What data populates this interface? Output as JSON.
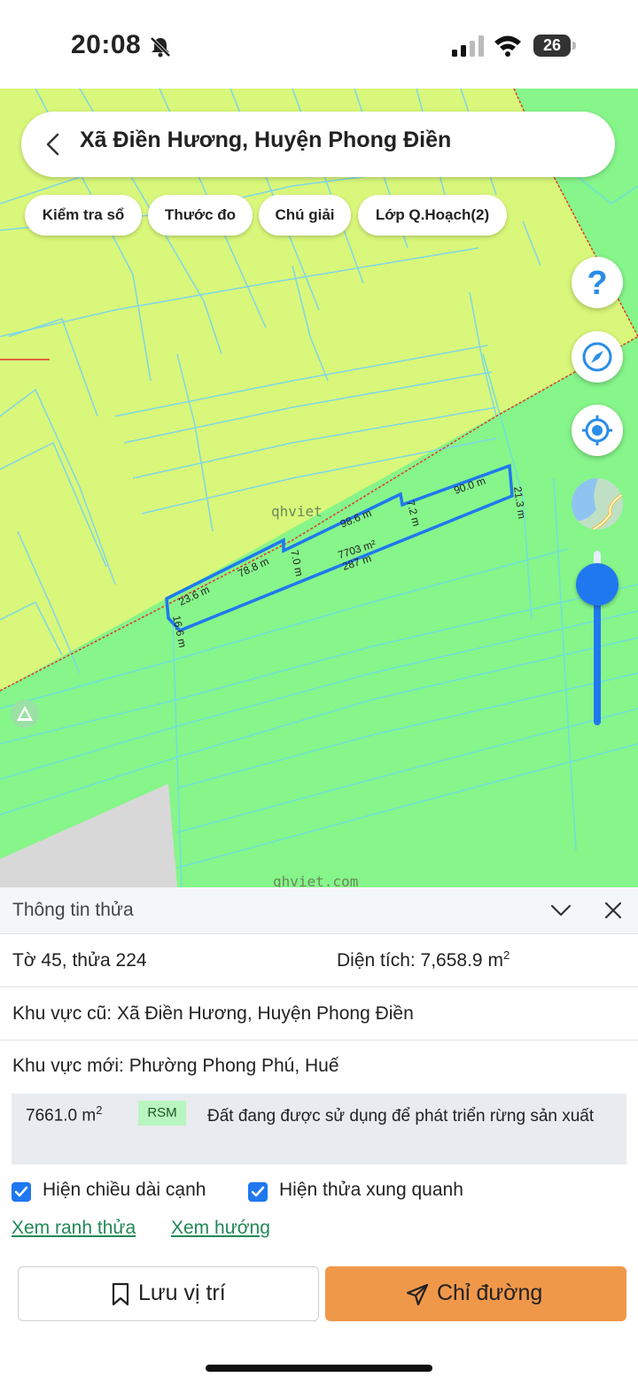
{
  "status_bar": {
    "time": "20:08",
    "battery": "26"
  },
  "search": {
    "title": "Xã Điền Hương, Huyện Phong Điền"
  },
  "chips": [
    "Kiểm tra sổ",
    "Thước đo",
    "Chú giải",
    "Lớp Q.Hoạch(2)"
  ],
  "map": {
    "watermark": "qhviet",
    "watermark_bottom": "qhviet.com",
    "edge_labels": [
      "23.6 m",
      "78.8 m",
      "7.0 m",
      "98.6 m",
      "7.2 m",
      "90.0 m",
      "21.3 m",
      "16.6 m"
    ],
    "parcel_area": "7703 m²",
    "parcel_perimeter": "287 m",
    "zoom_level": 0.12,
    "colors": {
      "residential": "#d9f77a",
      "forest": "#86f58a",
      "boundary": "#1f78f0",
      "admin_line": "#e03a2a"
    }
  },
  "panel": {
    "title": "Thông tin thửa",
    "sheet_plot": "Tờ 45, thửa 224",
    "area_label": "Diện tích: 7,658.9 m",
    "area_sup": "2",
    "old_area": "Khu vực cũ: Xã Điền Hương, Huyện Phong Điền",
    "new_area": "Khu vực mới: Phường Phong Phú, Huế",
    "land_use": {
      "area": "7661.0 m",
      "area_sup": "2",
      "code": "RSM",
      "description": "Đất đang được sử dụng để phát triển rừng sản xuất"
    },
    "checkbox_edge_length": "Hiện chiều dài cạnh",
    "checkbox_neighbors": "Hiện thửa xung quanh",
    "link_boundary": "Xem ranh thửa",
    "link_direction": "Xem hướng",
    "save_button": "Lưu vị trí",
    "directions_button": "Chỉ đường"
  }
}
